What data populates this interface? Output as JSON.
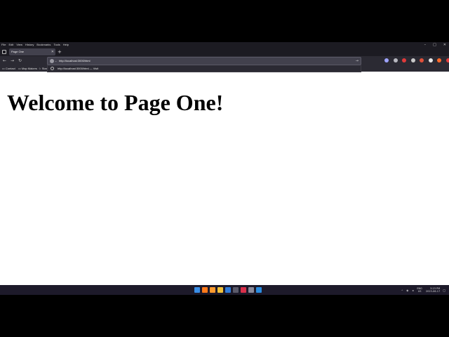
{
  "menu": [
    "File",
    "Edit",
    "View",
    "History",
    "Bookmarks",
    "Tools",
    "Help"
  ],
  "window_controls": {
    "minimize": "–",
    "maximize": "□",
    "close": "✕"
  },
  "tab": {
    "title": "Page One",
    "close": "✕"
  },
  "new_tab": "+",
  "nav": {
    "back": "←",
    "forward": "→",
    "reload": "↻"
  },
  "urlbar": {
    "value": "http://localhost:3000/html",
    "go": "→"
  },
  "url_suggestion": {
    "text": "http://localhost:3000/html — Visit"
  },
  "bookmarks": [
    {
      "icon": "folder-icon",
      "label": "Contact"
    },
    {
      "icon": "map-icon",
      "label": "Map Makers"
    },
    {
      "icon": "star-icon",
      "label": "Stan"
    }
  ],
  "page": {
    "heading": "Welcome to Page One!"
  },
  "extension_colors": [
    "#9ea3ff",
    "#b8b8c0",
    "#e03a3a",
    "#c8c8c8",
    "#e0503a",
    "#e8e8e8",
    "#ff6a2a",
    "#e23c3c",
    "#f0c020",
    "#c0c0c0"
  ],
  "taskbar": {
    "apps": [
      {
        "icon": "windows-start-icon",
        "color": "#3a8ee6"
      },
      {
        "icon": "firefox-icon",
        "color": "#ff7a1a"
      },
      {
        "icon": "firefox-alt-icon",
        "color": "#ff9b2e"
      },
      {
        "icon": "file-explorer-icon",
        "color": "#f2c23a"
      },
      {
        "icon": "mail-icon",
        "color": "#2f7bd9"
      },
      {
        "icon": "terminal-icon",
        "color": "#5a5a6a"
      },
      {
        "icon": "app-red-icon",
        "color": "#d9304a"
      },
      {
        "icon": "settings-icon",
        "color": "#8a8a9a"
      },
      {
        "icon": "vscode-icon",
        "color": "#2a8ce0"
      }
    ],
    "tray": {
      "chevron": "^",
      "lang_top": "ENG",
      "lang_bottom": "US",
      "time": "3:23 PM",
      "date": "2023-06-17"
    }
  }
}
